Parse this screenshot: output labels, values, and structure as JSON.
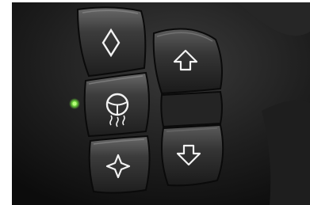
{
  "scene": {
    "subject": "steering-wheel-control-buttons",
    "colors": {
      "frame": "#ffffff",
      "panel_dark": "#141414",
      "leather": "#2a2a2a",
      "button_face": "#3e3e3e",
      "button_highlight": "#7a7a7a",
      "icon": "#f2f2f2",
      "indicator_led": "#7cd14a"
    },
    "buttons": [
      {
        "id": "diamond",
        "icon": "diamond-outline-icon"
      },
      {
        "id": "heated-wheel",
        "icon": "heated-steering-wheel-icon"
      },
      {
        "id": "star",
        "icon": "four-point-star-icon"
      },
      {
        "id": "up",
        "icon": "arrow-up-outline-icon"
      },
      {
        "id": "down",
        "icon": "arrow-down-outline-icon"
      }
    ]
  }
}
